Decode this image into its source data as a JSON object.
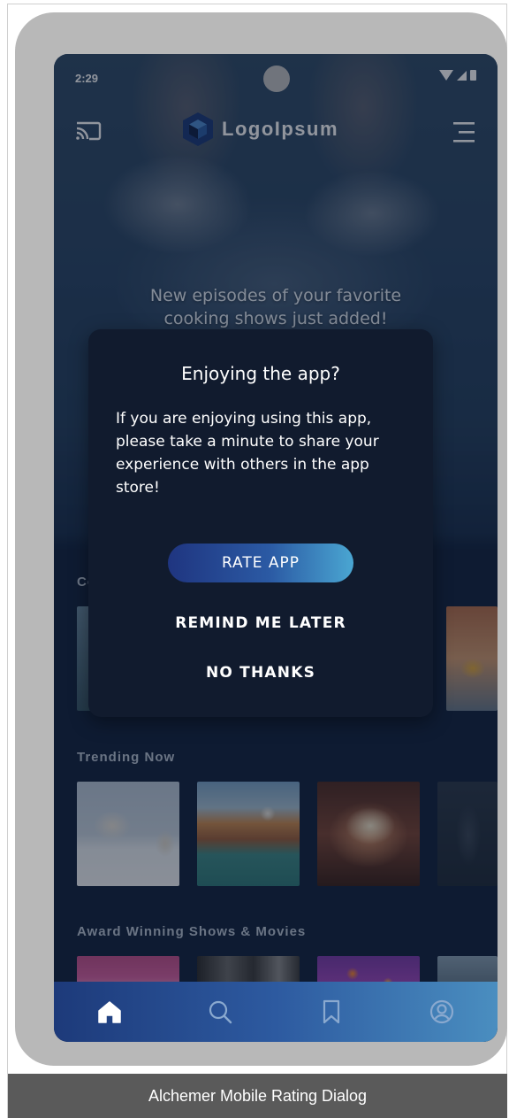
{
  "status_bar": {
    "time": "2:29"
  },
  "app": {
    "logo_text": "LogoIpsum"
  },
  "hero": {
    "line1": "New episodes of your favorite",
    "line2": "cooking shows just added!"
  },
  "sections": [
    {
      "title": "Co"
    },
    {
      "title": "Trending Now"
    },
    {
      "title": "Award Winning Shows & Movies"
    }
  ],
  "dialog": {
    "title": "Enjoying the app?",
    "body": "If you are enjoying using this app, please take a minute to share your experience with others in the app store!",
    "rate_label": "RATE APP",
    "remind_label": "REMIND ME LATER",
    "no_thanks_label": "NO THANKS"
  },
  "bottom_nav": [
    {
      "icon": "home-icon",
      "active": true
    },
    {
      "icon": "search-icon",
      "active": false
    },
    {
      "icon": "bookmark-icon",
      "active": false
    },
    {
      "icon": "profile-icon",
      "active": false
    }
  ],
  "caption": "Alchemer Mobile Rating Dialog",
  "colors": {
    "dialog_bg": "#111b2e",
    "screen_bg": "#11223d",
    "button_gradient_start": "#1f3580",
    "button_gradient_end": "#4aa6d2",
    "phone_frame": "#b8b8b8",
    "caption_bg": "#5a5a5a"
  }
}
